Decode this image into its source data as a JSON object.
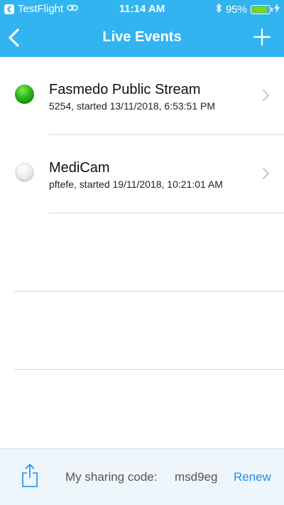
{
  "status_bar": {
    "carrier": "TestFlight",
    "time": "11:14 AM",
    "battery_percent": "95%",
    "battery_level": 0.95,
    "icons": [
      "back-to-app-icon",
      "link-icon",
      "bluetooth-icon",
      "battery-icon",
      "charging-bolt-icon"
    ]
  },
  "nav": {
    "title": "Live Events",
    "back_icon": "chevron-left-icon",
    "add_icon": "plus-icon"
  },
  "events": [
    {
      "name": "Fasmedo Public Stream",
      "subtitle": "5254, started 13/11/2018, 6:53:51 PM",
      "status": "live",
      "status_color": "#22b014"
    },
    {
      "name": "MediCam",
      "subtitle": "pftefe, started 19/11/2018, 10:21:01 AM",
      "status": "idle",
      "status_color": "#e6e6e6"
    }
  ],
  "footer": {
    "sharing_label": "My sharing code:",
    "sharing_code": "msd9eg",
    "renew_label": "Renew",
    "share_icon": "share-icon"
  },
  "colors": {
    "accent": "#32b4f0",
    "link": "#1a8ef0",
    "footer_bg": "#eef6fc"
  }
}
